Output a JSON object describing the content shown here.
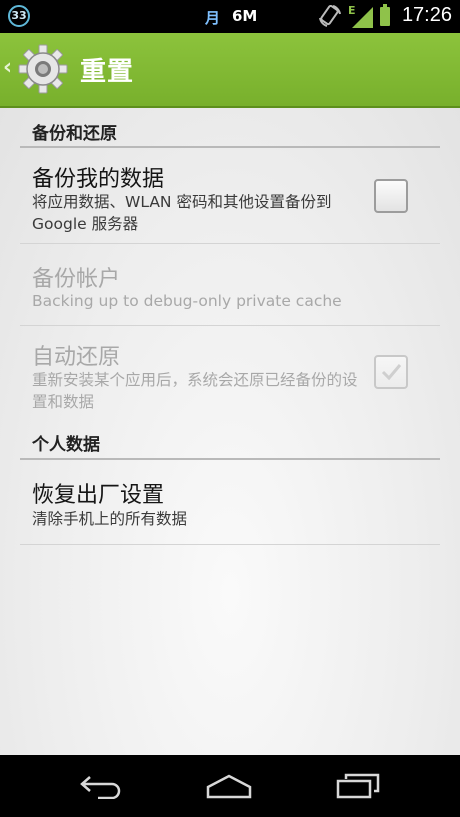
{
  "status_bar": {
    "notification_count": "33",
    "calendar_glyph": "月",
    "data_usage": "6M",
    "network_type": "E",
    "time": "17:26",
    "icons": [
      "notification-count-icon",
      "calendar-icon",
      "rotate-icon",
      "signal-icon",
      "battery-icon"
    ]
  },
  "action_bar": {
    "title": "重置",
    "back_glyph": "‹",
    "icon": "gear-icon"
  },
  "sections": [
    {
      "header": "备份和还原",
      "items": [
        {
          "title": "备份我的数据",
          "subtitle": "将应用数据、WLAN 密码和其他设置备份到 Google 服务器",
          "checkbox": true,
          "checked": false,
          "enabled": true
        },
        {
          "title": "备份帐户",
          "subtitle": "Backing up to debug-only private cache",
          "checkbox": false,
          "enabled": false
        },
        {
          "title": "自动还原",
          "subtitle": "重新安装某个应用后，系统会还原已经备份的设置和数据",
          "checkbox": true,
          "checked": true,
          "enabled": false
        }
      ]
    },
    {
      "header": "个人数据",
      "items": [
        {
          "title": "恢复出厂设置",
          "subtitle": "清除手机上的所有数据",
          "checkbox": false,
          "enabled": true
        }
      ]
    }
  ],
  "nav_bar": {
    "buttons": [
      "back-icon",
      "home-icon",
      "recent-apps-icon"
    ]
  },
  "colors": {
    "action_bar": "#80b834",
    "status_accent": "#8fc24a",
    "calendar_accent": "#7fc0ff"
  }
}
